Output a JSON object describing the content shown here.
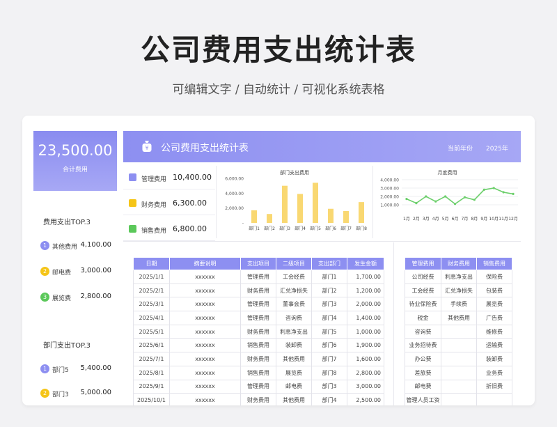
{
  "hero": {
    "title": "公司费用支出统计表",
    "subtitle": "可编辑文字 / 自动统计 / 可视化系统表格"
  },
  "summary": {
    "total": "23,500.00",
    "total_label": "合计费用"
  },
  "top_expense": {
    "title": "费用支出TOP.3",
    "items": [
      {
        "rank": "1",
        "name": "其他费用",
        "value": "4,100.00",
        "color": "#8d8ff1"
      },
      {
        "rank": "2",
        "name": "邮电费",
        "value": "3,000.00",
        "color": "#f5c518"
      },
      {
        "rank": "3",
        "name": "展览费",
        "value": "2,800.00",
        "color": "#5bc85a"
      }
    ]
  },
  "top_dept": {
    "title": "部门支出TOP.3",
    "items": [
      {
        "rank": "1",
        "name": "部门5",
        "value": "5,400.00",
        "color": "#8d8ff1"
      },
      {
        "rank": "2",
        "name": "部门3",
        "value": "5,000.00",
        "color": "#f5c518"
      }
    ]
  },
  "header": {
    "title": "公司费用支出统计表",
    "year_label": "当前年份",
    "year": "2025年"
  },
  "metrics": [
    {
      "name": "管理费用",
      "value": "10,400.00",
      "color": "#8d8ff1"
    },
    {
      "name": "财务费用",
      "value": "6,300.00",
      "color": "#f5c518"
    },
    {
      "name": "销售费用",
      "value": "6,800.00",
      "color": "#5bc85a"
    }
  ],
  "chart_data": [
    {
      "type": "bar",
      "title": "部门支出费用",
      "categories": [
        "部门1",
        "部门2",
        "部门3",
        "部门4",
        "部门5",
        "部门6",
        "部门7",
        "部门8"
      ],
      "values": [
        1700,
        1200,
        5000,
        3900,
        5400,
        1900,
        1600,
        2800
      ],
      "yticks": [
        "6,000.00",
        "4,000.00",
        "2,000.00",
        "-"
      ],
      "ylim": [
        0,
        6000
      ],
      "color": "#f9d872"
    },
    {
      "type": "line",
      "title": "月度费用",
      "categories": [
        "1月",
        "2月",
        "3月",
        "4月",
        "5月",
        "6月",
        "7月",
        "8月",
        "9月",
        "10月",
        "11月",
        "12月"
      ],
      "values": [
        1700,
        1200,
        2000,
        1400,
        2000,
        1100,
        1900,
        1600,
        2800,
        3000,
        2500,
        2300
      ],
      "yticks": [
        "4,000.00",
        "3,000.00",
        "2,000.00",
        "1,000.00"
      ],
      "ylim": [
        0,
        4000
      ],
      "color": "#6ccf6b"
    }
  ],
  "detail_table": {
    "headers": [
      "日期",
      "摘要说明",
      "支出项目",
      "二级项目",
      "支出部门",
      "发生金额"
    ],
    "rows": [
      [
        "2025/1/1",
        "xxxxxx",
        "管理费用",
        "工会经费",
        "部门1",
        "1,700.00"
      ],
      [
        "2025/2/1",
        "xxxxxx",
        "财务费用",
        "汇兑净损失",
        "部门2",
        "1,200.00"
      ],
      [
        "2025/3/1",
        "xxxxxx",
        "管理费用",
        "董事会费",
        "部门3",
        "2,000.00"
      ],
      [
        "2025/4/1",
        "xxxxxx",
        "管理费用",
        "咨询费",
        "部门4",
        "1,400.00"
      ],
      [
        "2025/5/1",
        "xxxxxx",
        "财务费用",
        "利息净支出",
        "部门5",
        "1,000.00"
      ],
      [
        "2025/6/1",
        "xxxxxx",
        "销售费用",
        "装卸费",
        "部门6",
        "1,900.00"
      ],
      [
        "2025/7/1",
        "xxxxxx",
        "财务费用",
        "其他费用",
        "部门7",
        "1,600.00"
      ],
      [
        "2025/8/1",
        "xxxxxx",
        "销售费用",
        "展览费",
        "部门8",
        "2,800.00"
      ],
      [
        "2025/9/1",
        "xxxxxx",
        "管理费用",
        "邮电费",
        "部门3",
        "3,000.00"
      ],
      [
        "2025/10/1",
        "xxxxxx",
        "财务费用",
        "其他费用",
        "部门4",
        "2,500.00"
      ]
    ]
  },
  "category_table": {
    "headers": [
      "管理费用",
      "财务费用",
      "销售费用"
    ],
    "rows": [
      [
        "公司经费",
        "利息净支出",
        "保险费"
      ],
      [
        "工会经费",
        "汇兑净损失",
        "包装费"
      ],
      [
        "待业保险费",
        "手续费",
        "展览费"
      ],
      [
        "税金",
        "其他费用",
        "广告费"
      ],
      [
        "咨询费",
        "",
        "维修费"
      ],
      [
        "业务招待费",
        "",
        "运输费"
      ],
      [
        "办公费",
        "",
        "装卸费"
      ],
      [
        "差旅费",
        "",
        "业务费"
      ],
      [
        "邮电费",
        "",
        "折旧费"
      ],
      [
        "管理人员工资",
        "",
        ""
      ]
    ]
  }
}
